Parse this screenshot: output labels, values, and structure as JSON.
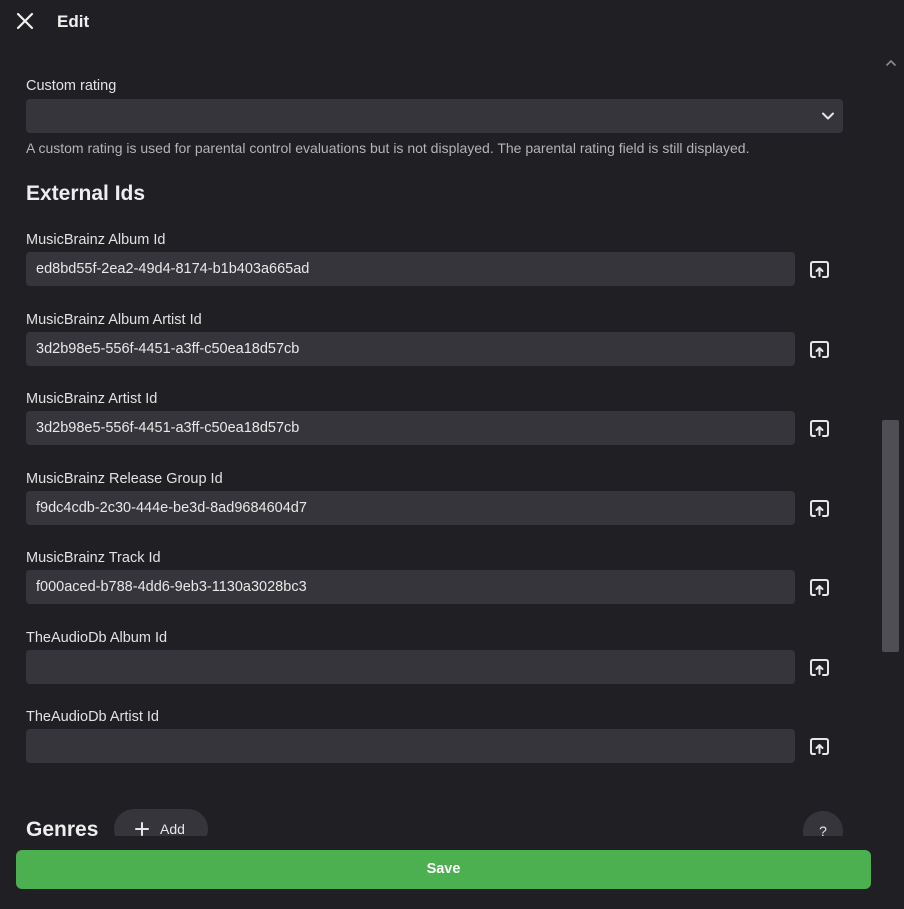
{
  "header": {
    "title": "Edit"
  },
  "custom_rating": {
    "label": "Custom rating",
    "value": "",
    "help": "A custom rating is used for parental control evaluations but is not displayed. The parental rating field is still displayed."
  },
  "external_ids": {
    "title": "External Ids",
    "fields": [
      {
        "label": "MusicBrainz Album Id",
        "value": "ed8bd55f-2ea2-49d4-8174-b1b403a665ad"
      },
      {
        "label": "MusicBrainz Album Artist Id",
        "value": "3d2b98e5-556f-4451-a3ff-c50ea18d57cb"
      },
      {
        "label": "MusicBrainz Artist Id",
        "value": "3d2b98e5-556f-4451-a3ff-c50ea18d57cb"
      },
      {
        "label": "MusicBrainz Release Group Id",
        "value": "f9dc4cdb-2c30-444e-be3d-8ad9684604d7"
      },
      {
        "label": "MusicBrainz Track Id",
        "value": "f000aced-b788-4dd6-9eb3-1130a3028bc3"
      },
      {
        "label": "TheAudioDb Album Id",
        "value": ""
      },
      {
        "label": "TheAudioDb Artist Id",
        "value": ""
      }
    ]
  },
  "genres": {
    "title": "Genres",
    "add_label": "Add",
    "help_label": "?"
  },
  "footer": {
    "save_label": "Save"
  },
  "icons": {
    "close": "close-icon",
    "chevron": "chevron-down-icon",
    "open_external": "open-in-new-icon",
    "plus": "plus-icon",
    "scroll_up": "chevron-up-icon"
  },
  "colors": {
    "background": "#202024",
    "field": "#35353b",
    "save": "#4caf50"
  }
}
